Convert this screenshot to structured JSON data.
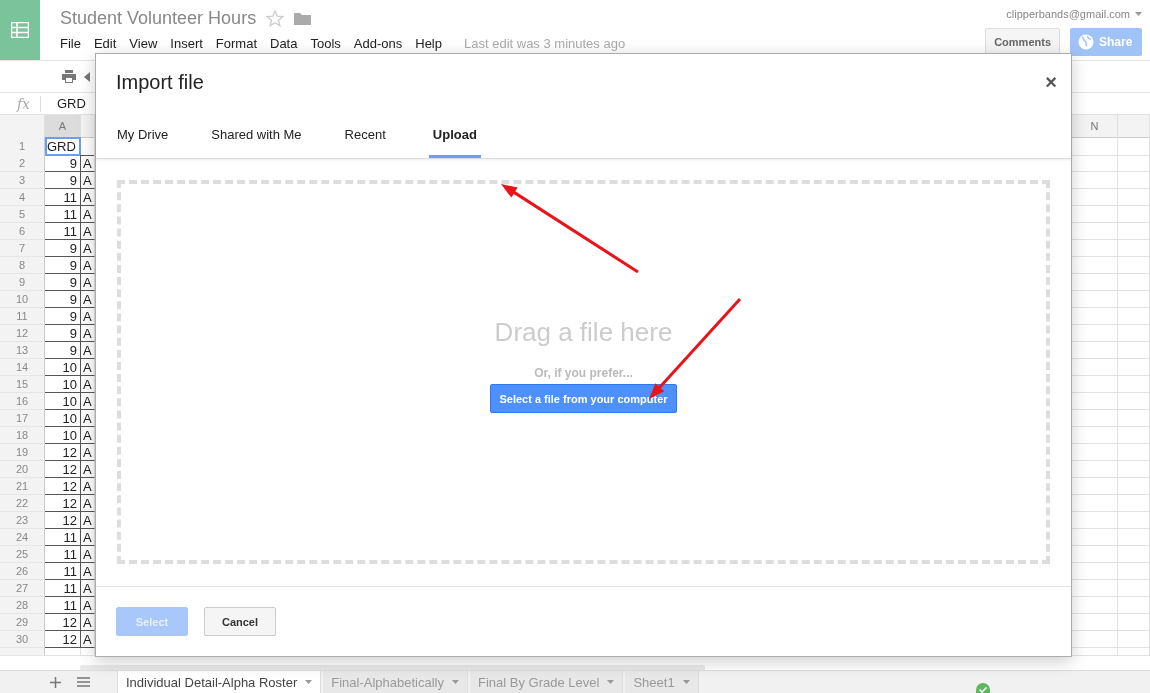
{
  "app": {
    "title": "Student Volunteer Hours",
    "menu": [
      "File",
      "Edit",
      "View",
      "Insert",
      "Format",
      "Data",
      "Tools",
      "Add-ons",
      "Help"
    ],
    "last_edit": "Last edit was 3 minutes ago",
    "account": "clipperbands@gmail.com",
    "comments": "Comments",
    "share": "Share"
  },
  "formula_bar": {
    "label": "fx",
    "value": "GRD"
  },
  "grid": {
    "columns": [
      "A",
      "N"
    ],
    "rows": [
      {
        "number": "1",
        "column_a": "GRD",
        "selected": true
      },
      {
        "number": "2",
        "column_a": "9",
        "column_b": "A",
        "selected": false
      },
      {
        "number": "3",
        "column_a": "9",
        "column_b": "A",
        "selected": false
      },
      {
        "number": "4",
        "column_a": "11",
        "column_b": "A",
        "selected": false
      },
      {
        "number": "5",
        "column_a": "11",
        "column_b": "A",
        "selected": false
      },
      {
        "number": "6",
        "column_a": "11",
        "column_b": "A",
        "selected": false
      },
      {
        "number": "7",
        "column_a": "9",
        "column_b": "A",
        "selected": false
      },
      {
        "number": "8",
        "column_a": "9",
        "column_b": "A",
        "selected": false
      },
      {
        "number": "9",
        "column_a": "9",
        "column_b": "A",
        "selected": false
      },
      {
        "number": "10",
        "column_a": "9",
        "column_b": "A",
        "selected": false
      },
      {
        "number": "11",
        "column_a": "9",
        "column_b": "A",
        "selected": false
      },
      {
        "number": "12",
        "column_a": "9",
        "column_b": "A",
        "selected": false
      },
      {
        "number": "13",
        "column_a": "9",
        "column_b": "A",
        "selected": false
      },
      {
        "number": "14",
        "column_a": "10",
        "column_b": "A",
        "selected": false
      },
      {
        "number": "15",
        "column_a": "10",
        "column_b": "A",
        "selected": false
      },
      {
        "number": "16",
        "column_a": "10",
        "column_b": "A",
        "selected": false
      },
      {
        "number": "17",
        "column_a": "10",
        "column_b": "A",
        "selected": false
      },
      {
        "number": "18",
        "column_a": "10",
        "column_b": "A",
        "selected": false
      },
      {
        "number": "19",
        "column_a": "12",
        "column_b": "A",
        "selected": false
      },
      {
        "number": "20",
        "column_a": "12",
        "column_b": "A",
        "selected": false
      },
      {
        "number": "21",
        "column_a": "12",
        "column_b": "A",
        "selected": false
      },
      {
        "number": "22",
        "column_a": "12",
        "column_b": "A",
        "selected": false
      },
      {
        "number": "23",
        "column_a": "12",
        "column_b": "A",
        "selected": false
      },
      {
        "number": "24",
        "column_a": "11",
        "column_b": "A",
        "selected": false
      },
      {
        "number": "25",
        "column_a": "11",
        "column_b": "A",
        "selected": false
      },
      {
        "number": "26",
        "column_a": "11",
        "column_b": "A",
        "selected": false
      },
      {
        "number": "27",
        "column_a": "11",
        "column_b": "A",
        "selected": false
      },
      {
        "number": "28",
        "column_a": "11",
        "column_b": "A",
        "selected": false
      },
      {
        "number": "29",
        "column_a": "12",
        "column_b": "A",
        "selected": false
      },
      {
        "number": "30",
        "column_a": "12",
        "column_b": "A",
        "selected": false
      }
    ]
  },
  "dialog": {
    "title": "Import file",
    "close": "×",
    "tabs": [
      {
        "label": "My Drive",
        "selected": false
      },
      {
        "label": "Shared with Me",
        "selected": false
      },
      {
        "label": "Recent",
        "selected": false
      },
      {
        "label": "Upload",
        "selected": true
      }
    ],
    "drop_text": "Drag a file here",
    "alt_text": "Or, if you prefer...",
    "upload_button": "Select a file from your computer",
    "buttons": [
      {
        "label": "Select",
        "kind": "primary",
        "disabled": true
      },
      {
        "label": "Cancel",
        "kind": "secondary",
        "disabled": false
      }
    ]
  },
  "sheet_tabs": [
    {
      "label": "Individual Detail-Alpha Roster",
      "selected": true
    },
    {
      "label": "Final-Alphabetically",
      "selected": false
    },
    {
      "label": "Final By Grade Level",
      "selected": false
    },
    {
      "label": "Sheet1",
      "selected": false
    }
  ]
}
